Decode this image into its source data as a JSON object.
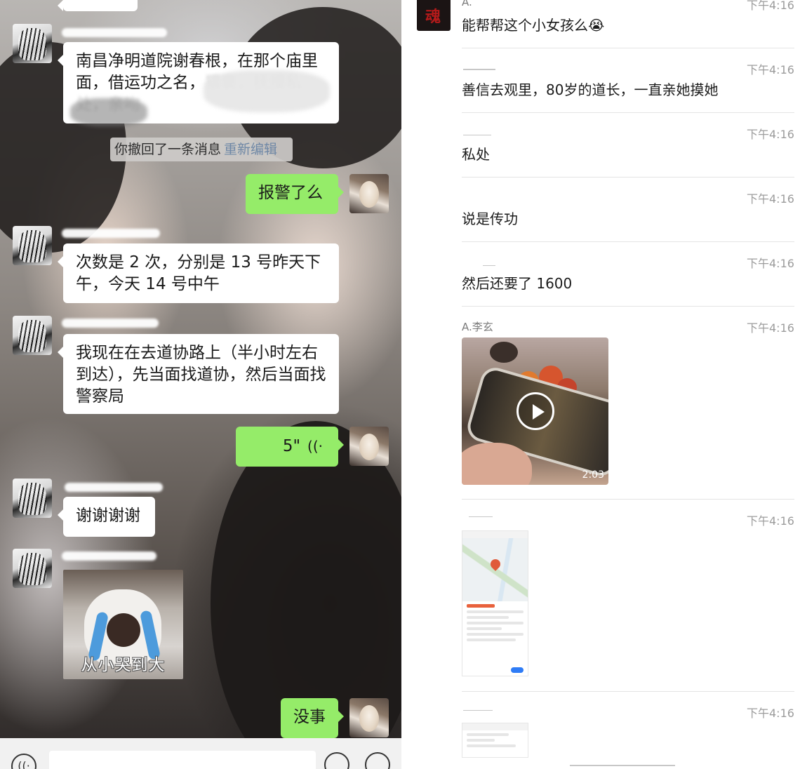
{
  "left_chat": {
    "messages": [
      {
        "side": "left",
        "text": "南昌净明道院谢春根，在那个庙里面，借运功之名，",
        "smudged": "猥亵，抚摸私处，亲吻"
      },
      {
        "side": "system",
        "text": "你撤回了一条消息",
        "action": "重新编辑"
      },
      {
        "side": "right",
        "text": "报警了么"
      },
      {
        "side": "left",
        "text": "次数是 2 次，分别是 13 号昨天下午，今天 14 号中午"
      },
      {
        "side": "left",
        "text": "我现在在去道协路上（半小时左右到达），先当面找道协，然后当面找警察局"
      },
      {
        "side": "right",
        "type": "voice",
        "duration": "5\"",
        "icon": "voice-wave-icon"
      },
      {
        "side": "left",
        "text": "谢谢谢谢"
      },
      {
        "side": "left",
        "type": "sticker",
        "caption": "从小哭到大"
      },
      {
        "side": "right",
        "text": "没事"
      }
    ]
  },
  "right_chat": {
    "top": {
      "name": "A.",
      "time": "下午4:16",
      "text": "能帮帮这个小女孩么",
      "emoji": "😭"
    },
    "posts": [
      {
        "time": "下午4:16",
        "text": "善信去观里，80岁的道长，一直亲她摸她"
      },
      {
        "time": "下午4:16",
        "text": "私处"
      },
      {
        "time": "下午4:16",
        "text": "说是传功"
      },
      {
        "time": "下午4:16",
        "text": "然后还要了 1600"
      },
      {
        "name": "A.李玄",
        "time": "下午4:16",
        "video_duration": "2:03"
      },
      {
        "time": "下午4:16"
      },
      {
        "time": "下午4:16"
      }
    ]
  },
  "colors": {
    "bubble_green": "#95ec69",
    "bubble_white": "#ffffff",
    "time_gray": "#9c9c9c",
    "link_blue": "#6f88a6"
  }
}
